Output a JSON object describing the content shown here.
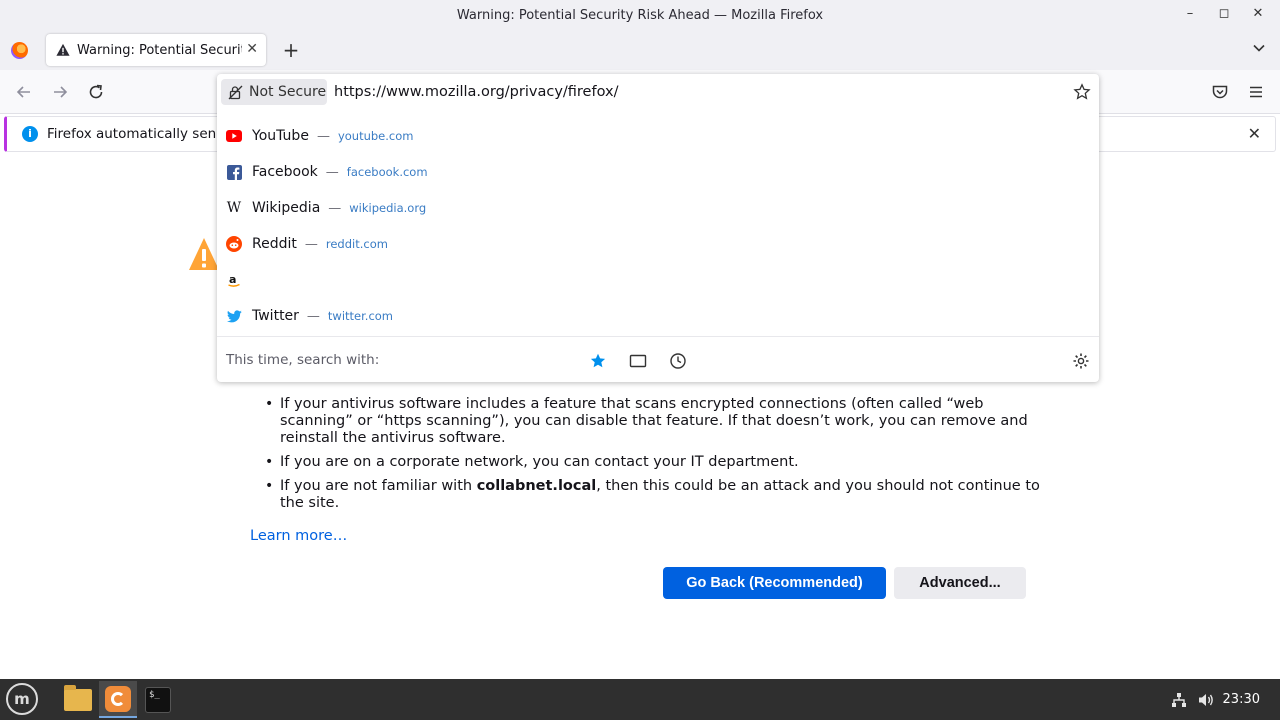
{
  "window": {
    "title": "Warning: Potential Security Risk Ahead — Mozilla Firefox"
  },
  "tab": {
    "label": "Warning: Potential Security Risk Ahead",
    "new_tab": "+"
  },
  "urlbar": {
    "security_label": "Not Secure",
    "url": "https://www.mozilla.org/privacy/firefox/"
  },
  "suggestions": [
    {
      "name": "YouTube",
      "url": "youtube.com",
      "icon": "youtube-icon",
      "color": "#ff0000"
    },
    {
      "name": "Facebook",
      "url": "facebook.com",
      "icon": "facebook-icon",
      "color": "#3b5998"
    },
    {
      "name": "Wikipedia",
      "url": "wikipedia.org",
      "icon": "wikipedia-icon",
      "color": "#222222"
    },
    {
      "name": "Reddit",
      "url": "reddit.com",
      "icon": "reddit-icon",
      "color": "#ff4500"
    },
    {
      "name": "",
      "url": "",
      "icon": "amazon-icon",
      "color": "#111111"
    },
    {
      "name": "Twitter",
      "url": "twitter.com",
      "icon": "twitter-icon",
      "color": "#1da1f2"
    }
  ],
  "suggestion_separator": "—",
  "search_with": {
    "label": "This time, search with:"
  },
  "notification": {
    "text": "Firefox automatically sends s"
  },
  "page": {
    "bullets": [
      {
        "text": "If your antivirus software includes a feature that scans encrypted connections (often called “web scanning” or “https scanning”), you can disable that feature. If that doesn’t work, you can remove and reinstall the antivirus software."
      },
      {
        "text": "If you are on a corporate network, you can contact your IT department."
      },
      {
        "pre": "If you are not familiar with ",
        "bold": "collabnet.local",
        "post": ", then this could be an attack and you should not continue to the site."
      }
    ],
    "learn_more": "Learn more…",
    "go_back": "Go Back (Recommended)",
    "advanced": "Advanced..."
  },
  "taskbar": {
    "clock": "23:30",
    "menu_logo": "m"
  },
  "colors": {
    "accent": "#0061e0",
    "warning": "#ffa436",
    "info": "#0090ed"
  }
}
